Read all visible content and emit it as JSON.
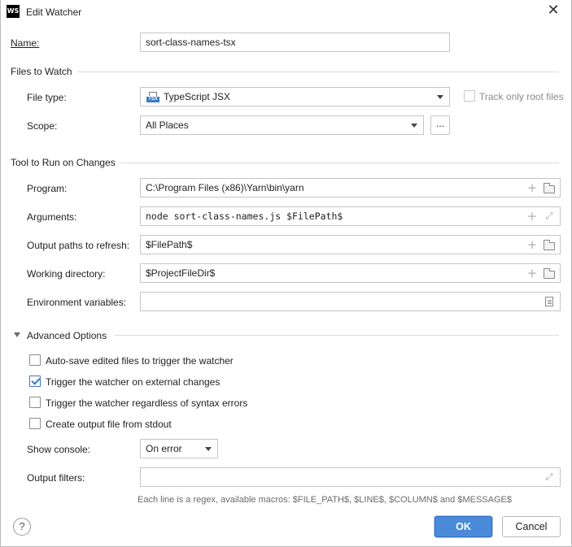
{
  "window": {
    "title": "Edit Watcher",
    "logo_text": "WS"
  },
  "name_row": {
    "label": "Name:",
    "value": "sort-class-names-tsx"
  },
  "files_to_watch": {
    "section_title": "Files to Watch",
    "file_type_label": "File type:",
    "file_type_value": "TypeScript JSX",
    "file_type_icon_text": "TSX",
    "track_root_label": "Track only root files",
    "scope_label": "Scope:",
    "scope_value": "All Places",
    "scope_more_label": "..."
  },
  "tool": {
    "section_title": "Tool to Run on Changes",
    "program_label": "Program:",
    "program_value": "C:\\Program Files (x86)\\Yarn\\bin\\yarn",
    "arguments_label": "Arguments:",
    "arguments_value": "node sort-class-names.js $FilePath$",
    "output_paths_label": "Output paths to refresh:",
    "output_paths_value": "$FilePath$",
    "working_dir_label": "Working directory:",
    "working_dir_value": "$ProjectFileDir$",
    "env_label": "Environment variables:",
    "env_value": ""
  },
  "advanced": {
    "section_title": "Advanced Options",
    "options": [
      {
        "label": "Auto-save edited files to trigger the watcher",
        "checked": false
      },
      {
        "label": "Trigger the watcher on external changes",
        "checked": true
      },
      {
        "label": "Trigger the watcher regardless of syntax errors",
        "checked": false
      },
      {
        "label": "Create output file from stdout",
        "checked": false
      }
    ],
    "show_console_label": "Show console:",
    "show_console_value": "On error",
    "output_filters_label": "Output filters:",
    "output_filters_value": "",
    "hint": "Each line is a regex, available macros: $FILE_PATH$, $LINE$, $COLUMN$ and $MESSAGE$"
  },
  "footer": {
    "help_label": "?",
    "ok_label": "OK",
    "cancel_label": "Cancel"
  },
  "colors": {
    "accent": "#4a8ad8",
    "checkbox_check": "#3b79c4"
  }
}
